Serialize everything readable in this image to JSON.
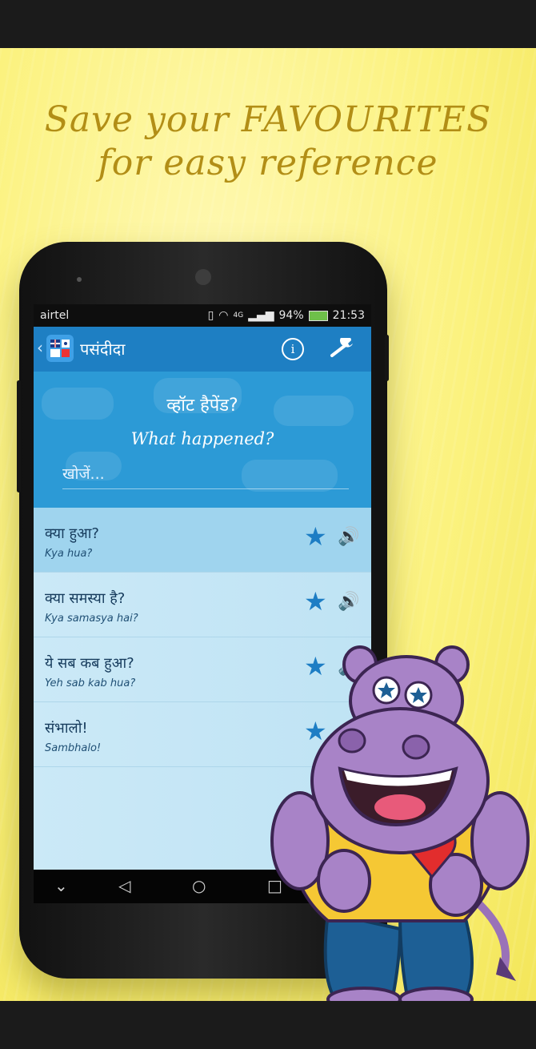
{
  "promo": {
    "headline_line1": "Save your FAVOURITES",
    "headline_line2": "for easy reference"
  },
  "statusbar": {
    "carrier": "airtel",
    "network": "4G",
    "battery": "94%",
    "time": "21:53"
  },
  "appbar": {
    "back_glyph": "‹",
    "title": "पसंदीदा",
    "info_glyph": "i",
    "settings_glyph": "🔧"
  },
  "hero": {
    "hindi_phrase": "व्हॉट हैपेंड?",
    "english_phrase": "What happened?",
    "search_placeholder": "खोजें..."
  },
  "favourites": [
    {
      "hindi": "क्या हुआ?",
      "transliteration": "Kya hua?"
    },
    {
      "hindi": "क्या समस्या है?",
      "transliteration": "Kya samasya hai?"
    },
    {
      "hindi": "ये सब कब हुआ?",
      "transliteration": "Yeh sab kab hua?"
    },
    {
      "hindi": "संभालो!",
      "transliteration": "Sambhalo!"
    }
  ],
  "icons": {
    "star": "★",
    "speaker": "🔊"
  },
  "navbar": {
    "down": "⌄",
    "back": "◁",
    "home": "○",
    "recents": "□"
  },
  "colors": {
    "accent": "#1e7fc3",
    "hero": "#2c9ad6",
    "headline": "#b28e16"
  }
}
